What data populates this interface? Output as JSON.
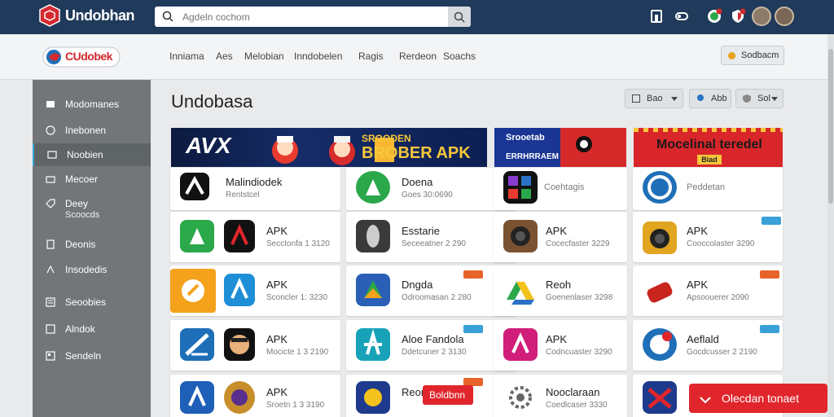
{
  "header": {
    "brand": "Undobhan",
    "search": {
      "placeholder": "Agdeln cochom",
      "value": ""
    }
  },
  "subnav": {
    "logo_text": "CUdobek",
    "items": [
      "Inniama",
      "Aes",
      "Melobian",
      "Inndobelen",
      "Ragis",
      "Rerdeon",
      "Soachs"
    ],
    "cta_label": "Sodbacm"
  },
  "sidebar": {
    "items": [
      {
        "label": "Modomanes",
        "sub": ""
      },
      {
        "label": "Inebonen",
        "sub": ""
      },
      {
        "label": "Noobien",
        "sub": ""
      },
      {
        "label": "Mecoer",
        "sub": ""
      },
      {
        "label": "Deey",
        "sub": "Scoocds"
      },
      {
        "label": "Deonis",
        "sub": ""
      },
      {
        "label": "Insodedis",
        "sub": ""
      },
      {
        "label": "Seoobies",
        "sub": ""
      },
      {
        "label": "Alndok",
        "sub": ""
      },
      {
        "label": "Sendeln",
        "sub": ""
      }
    ]
  },
  "main": {
    "title": "Undobasa",
    "toolbar": [
      {
        "label": "Bao"
      },
      {
        "label": "Abb"
      },
      {
        "label": "Sol"
      }
    ]
  },
  "banners": {
    "main_left": "AVX",
    "main_right_top": "SROODEN",
    "main_right_line": "BROBER APK",
    "b2_top": "Srooetab",
    "b2_bottom": "ERRHRRAEM",
    "b3_title": "Mocelinal teredel",
    "b3_chip": "Biad"
  },
  "rows": [
    [
      {
        "title": "Malindiodek",
        "sub": "Rentstcel"
      },
      {
        "title": "Doena",
        "sub": "Goes 30:0690"
      },
      {
        "title": "",
        "sub": "Coehtagis"
      },
      {
        "title": "",
        "sub": "Peddetan"
      }
    ],
    [
      {
        "title": "APK",
        "sub": "Secctonfa 1 3120"
      },
      {
        "title": "Esstarie",
        "sub": "Seceeatner 2 290"
      },
      {
        "title": "APK",
        "sub": "Cocecfaster 3229"
      },
      {
        "title": "APK",
        "sub": "Cooccolaster 3290"
      }
    ],
    [
      {
        "title": "APK",
        "sub": "Sconcler 1: 3230"
      },
      {
        "title": "Dngda",
        "sub": "Odroomasan 2 280"
      },
      {
        "title": "Reoh",
        "sub": "Goenenlaser 3298"
      },
      {
        "title": "APK",
        "sub": "Apsoouerer 2090"
      }
    ],
    [
      {
        "title": "APK",
        "sub": "Mocicte 1 3 2190"
      },
      {
        "title": "Aloe Fandola",
        "sub": "Ddetcuner 2 3130"
      },
      {
        "title": "APK",
        "sub": "Codncuaster 3290"
      },
      {
        "title": "Aeflald",
        "sub": "Gocdcusser 2 2190"
      }
    ],
    [
      {
        "title": "APK",
        "sub": "Sroetn 1 3 3190"
      },
      {
        "title": "Reone",
        "sub": ""
      },
      {
        "title": "Nooclaraan",
        "sub": "Coedlcaser 3330"
      },
      {
        "title": "",
        "sub": ""
      }
    ]
  ],
  "install_pill": "Boldbnn",
  "float_cta": "Olecdan tonaet",
  "colors": {
    "header_bg": "#1f3a5a",
    "sidebar_bg": "#737678",
    "accent_red": "#e0262c",
    "accent_blue": "#3aa0d8"
  }
}
